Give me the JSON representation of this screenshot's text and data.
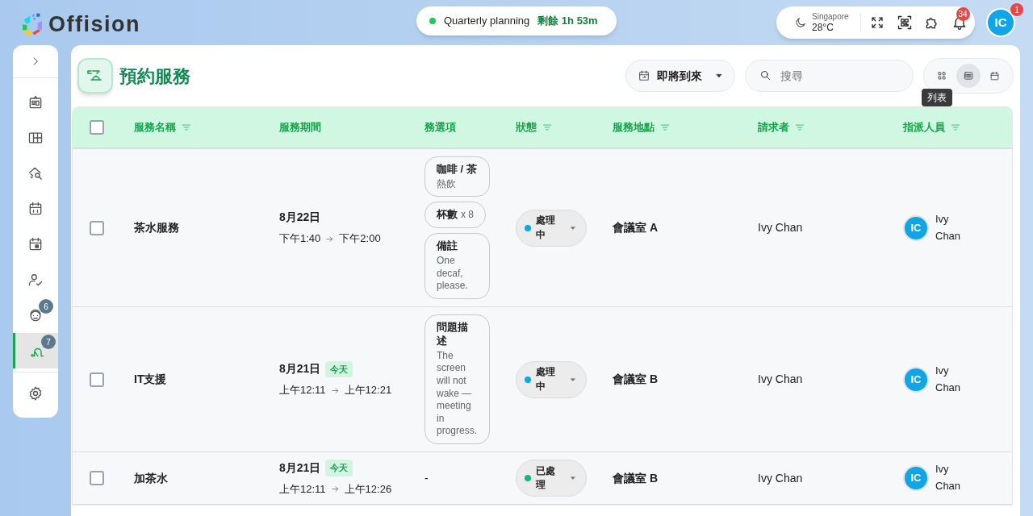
{
  "brand": {
    "name": "Offision"
  },
  "meeting": {
    "title": "Quarterly planning",
    "remaining": "剩餘 1h 53m",
    "live": true
  },
  "weather": {
    "city": "Singapore",
    "temperature": "28°C"
  },
  "notifications": {
    "count": "34"
  },
  "user": {
    "initials": "IC",
    "badge": "1"
  },
  "sidebar": {
    "items": [
      {
        "kind": "dashboard",
        "selected": false
      },
      {
        "kind": "layout",
        "selected": false
      },
      {
        "kind": "space-search",
        "selected": false
      },
      {
        "kind": "calendar",
        "selected": false
      },
      {
        "kind": "calendar-day",
        "selected": false
      },
      {
        "kind": "person-check",
        "selected": false
      },
      {
        "kind": "headset",
        "selected": false,
        "badge": "6"
      },
      {
        "kind": "cleaning",
        "selected": true,
        "badge": "7"
      }
    ],
    "footer_item": {
      "kind": "settings",
      "selected": false
    }
  },
  "page": {
    "title": "預約服務"
  },
  "filter": {
    "label": "即將到來"
  },
  "search": {
    "placeholder": "搜尋"
  },
  "view_toggle": [
    {
      "kind": "grid",
      "selected": false
    },
    {
      "kind": "list",
      "selected": true
    },
    {
      "kind": "calendar",
      "selected": false
    }
  ],
  "tooltip": "列表",
  "table": {
    "select_all": {
      "checked": false
    },
    "columns": [
      {
        "label": "服務名稱",
        "filter": true
      },
      {
        "label": "服務期間",
        "filter": false
      },
      {
        "label": "務選項",
        "filter": false
      },
      {
        "label": "狀態",
        "filter": true
      },
      {
        "label": "服務地點",
        "filter": true
      },
      {
        "label": "請求者",
        "filter": true
      },
      {
        "label": "指派人員",
        "filter": true
      }
    ],
    "rows": [
      {
        "checked": false,
        "service": "茶水服務",
        "date": "8月22日",
        "start": "下午1:40",
        "end": "下午2:00",
        "options": [
          {
            "kind": "stacked",
            "title": "咖啡 / 茶",
            "detail": "熱飲"
          },
          {
            "kind": "inline",
            "title": "杯數",
            "detail": "x 8"
          },
          {
            "kind": "stacked",
            "title": "備註",
            "detail": "One decaf, please."
          }
        ],
        "status": {
          "label": "處理中",
          "color": "#0ea5e9"
        },
        "location": "會議室 A",
        "requester": "Ivy Chan",
        "assignee": {
          "initials": "IC",
          "name": "Ivy Chan"
        }
      },
      {
        "checked": false,
        "service": "IT支援",
        "date": "8月21日",
        "today": "今天",
        "start": "上午12:11",
        "end": "上午12:21",
        "options": [
          {
            "kind": "stacked",
            "title": "問題描述",
            "detail": "The screen will not wake — meeting in progress."
          }
        ],
        "status": {
          "label": "處理中",
          "color": "#0ea5e9"
        },
        "location": "會議室 B",
        "requester": "Ivy Chan",
        "assignee": {
          "initials": "IC",
          "name": "Ivy Chan"
        }
      },
      {
        "checked": false,
        "service": "加茶水",
        "date": "8月21日",
        "today": "今天",
        "start": "上午12:11",
        "end": "上午12:26",
        "options_text": "-",
        "status": {
          "label": "已處理",
          "color": "#10b981"
        },
        "location": "會議室 B",
        "requester": "Ivy Chan",
        "assignee": {
          "initials": "IC",
          "name": "Ivy Chan"
        }
      }
    ]
  }
}
